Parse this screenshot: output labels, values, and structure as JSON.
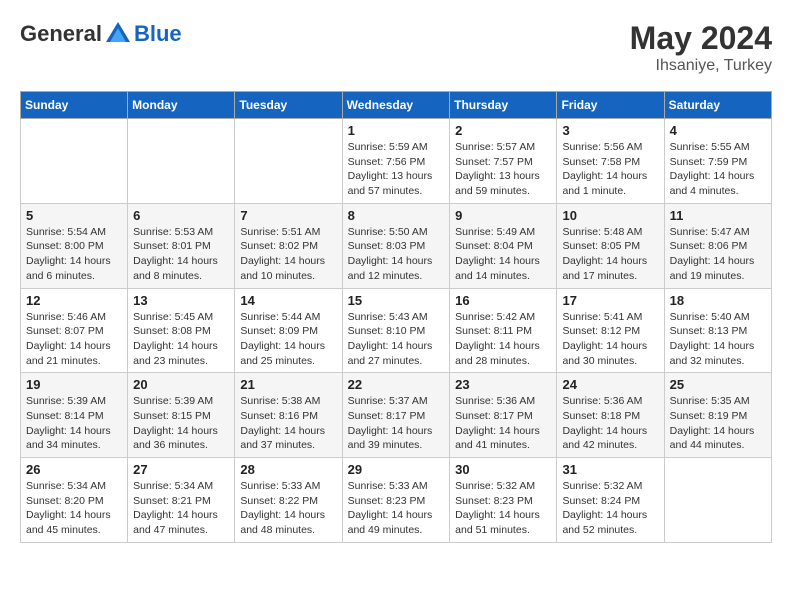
{
  "header": {
    "logo_general": "General",
    "logo_blue": "Blue",
    "month_year": "May 2024",
    "location": "Ihsaniye, Turkey"
  },
  "weekdays": [
    "Sunday",
    "Monday",
    "Tuesday",
    "Wednesday",
    "Thursday",
    "Friday",
    "Saturday"
  ],
  "weeks": [
    [
      {
        "day": "",
        "info": ""
      },
      {
        "day": "",
        "info": ""
      },
      {
        "day": "",
        "info": ""
      },
      {
        "day": "1",
        "info": "Sunrise: 5:59 AM\nSunset: 7:56 PM\nDaylight: 13 hours and 57 minutes."
      },
      {
        "day": "2",
        "info": "Sunrise: 5:57 AM\nSunset: 7:57 PM\nDaylight: 13 hours and 59 minutes."
      },
      {
        "day": "3",
        "info": "Sunrise: 5:56 AM\nSunset: 7:58 PM\nDaylight: 14 hours and 1 minute."
      },
      {
        "day": "4",
        "info": "Sunrise: 5:55 AM\nSunset: 7:59 PM\nDaylight: 14 hours and 4 minutes."
      }
    ],
    [
      {
        "day": "5",
        "info": "Sunrise: 5:54 AM\nSunset: 8:00 PM\nDaylight: 14 hours and 6 minutes."
      },
      {
        "day": "6",
        "info": "Sunrise: 5:53 AM\nSunset: 8:01 PM\nDaylight: 14 hours and 8 minutes."
      },
      {
        "day": "7",
        "info": "Sunrise: 5:51 AM\nSunset: 8:02 PM\nDaylight: 14 hours and 10 minutes."
      },
      {
        "day": "8",
        "info": "Sunrise: 5:50 AM\nSunset: 8:03 PM\nDaylight: 14 hours and 12 minutes."
      },
      {
        "day": "9",
        "info": "Sunrise: 5:49 AM\nSunset: 8:04 PM\nDaylight: 14 hours and 14 minutes."
      },
      {
        "day": "10",
        "info": "Sunrise: 5:48 AM\nSunset: 8:05 PM\nDaylight: 14 hours and 17 minutes."
      },
      {
        "day": "11",
        "info": "Sunrise: 5:47 AM\nSunset: 8:06 PM\nDaylight: 14 hours and 19 minutes."
      }
    ],
    [
      {
        "day": "12",
        "info": "Sunrise: 5:46 AM\nSunset: 8:07 PM\nDaylight: 14 hours and 21 minutes."
      },
      {
        "day": "13",
        "info": "Sunrise: 5:45 AM\nSunset: 8:08 PM\nDaylight: 14 hours and 23 minutes."
      },
      {
        "day": "14",
        "info": "Sunrise: 5:44 AM\nSunset: 8:09 PM\nDaylight: 14 hours and 25 minutes."
      },
      {
        "day": "15",
        "info": "Sunrise: 5:43 AM\nSunset: 8:10 PM\nDaylight: 14 hours and 27 minutes."
      },
      {
        "day": "16",
        "info": "Sunrise: 5:42 AM\nSunset: 8:11 PM\nDaylight: 14 hours and 28 minutes."
      },
      {
        "day": "17",
        "info": "Sunrise: 5:41 AM\nSunset: 8:12 PM\nDaylight: 14 hours and 30 minutes."
      },
      {
        "day": "18",
        "info": "Sunrise: 5:40 AM\nSunset: 8:13 PM\nDaylight: 14 hours and 32 minutes."
      }
    ],
    [
      {
        "day": "19",
        "info": "Sunrise: 5:39 AM\nSunset: 8:14 PM\nDaylight: 14 hours and 34 minutes."
      },
      {
        "day": "20",
        "info": "Sunrise: 5:39 AM\nSunset: 8:15 PM\nDaylight: 14 hours and 36 minutes."
      },
      {
        "day": "21",
        "info": "Sunrise: 5:38 AM\nSunset: 8:16 PM\nDaylight: 14 hours and 37 minutes."
      },
      {
        "day": "22",
        "info": "Sunrise: 5:37 AM\nSunset: 8:17 PM\nDaylight: 14 hours and 39 minutes."
      },
      {
        "day": "23",
        "info": "Sunrise: 5:36 AM\nSunset: 8:17 PM\nDaylight: 14 hours and 41 minutes."
      },
      {
        "day": "24",
        "info": "Sunrise: 5:36 AM\nSunset: 8:18 PM\nDaylight: 14 hours and 42 minutes."
      },
      {
        "day": "25",
        "info": "Sunrise: 5:35 AM\nSunset: 8:19 PM\nDaylight: 14 hours and 44 minutes."
      }
    ],
    [
      {
        "day": "26",
        "info": "Sunrise: 5:34 AM\nSunset: 8:20 PM\nDaylight: 14 hours and 45 minutes."
      },
      {
        "day": "27",
        "info": "Sunrise: 5:34 AM\nSunset: 8:21 PM\nDaylight: 14 hours and 47 minutes."
      },
      {
        "day": "28",
        "info": "Sunrise: 5:33 AM\nSunset: 8:22 PM\nDaylight: 14 hours and 48 minutes."
      },
      {
        "day": "29",
        "info": "Sunrise: 5:33 AM\nSunset: 8:23 PM\nDaylight: 14 hours and 49 minutes."
      },
      {
        "day": "30",
        "info": "Sunrise: 5:32 AM\nSunset: 8:23 PM\nDaylight: 14 hours and 51 minutes."
      },
      {
        "day": "31",
        "info": "Sunrise: 5:32 AM\nSunset: 8:24 PM\nDaylight: 14 hours and 52 minutes."
      },
      {
        "day": "",
        "info": ""
      }
    ]
  ]
}
